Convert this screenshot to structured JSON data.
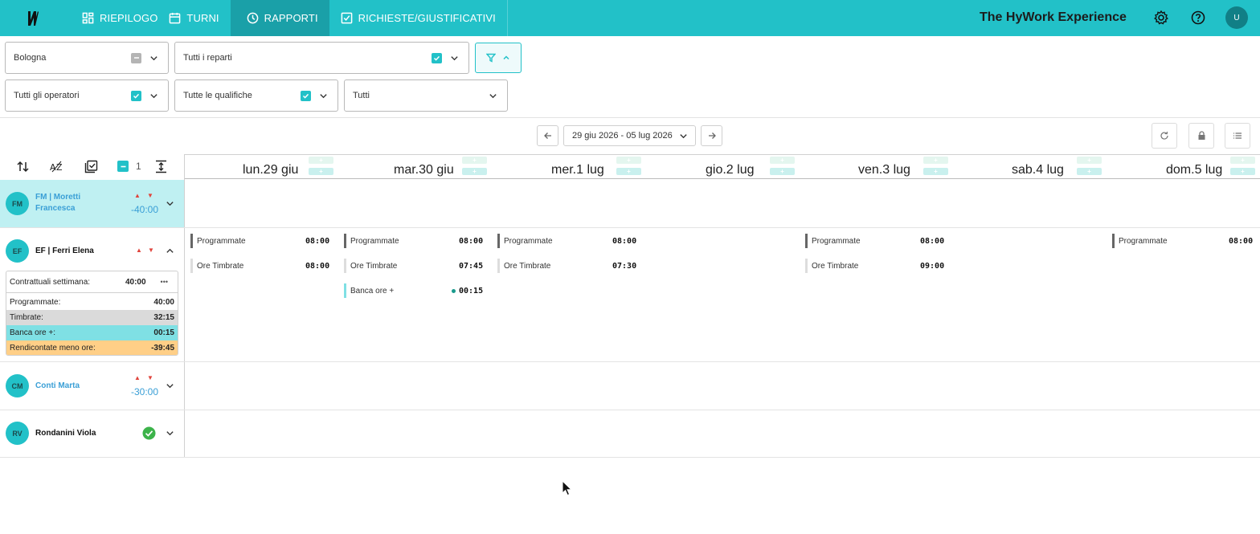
{
  "nav": {
    "items": [
      {
        "label": "RIEPILOGO",
        "icon": "dashboard-icon"
      },
      {
        "label": "TURNI",
        "icon": "calendar-icon"
      },
      {
        "label": "RAPPORTI",
        "icon": "clock-icon",
        "active": true
      },
      {
        "label": "RICHIESTE/GIUSTIFICATIVI",
        "icon": "checkbox-icon"
      }
    ],
    "brand": "The HyWork Experience",
    "user_initial": "U"
  },
  "filters": {
    "site": "Bologna",
    "departments": "Tutti i reparti",
    "operators": "Tutti gli operatori",
    "qualifications": "Tutte le qualifiche",
    "status": "Tutti"
  },
  "date_range": "29 giu 2026 - 05 lug 2026",
  "toolbar": {
    "selected_count": "1"
  },
  "days": [
    {
      "label": "lun.29 giu"
    },
    {
      "label": "mar.30 giu"
    },
    {
      "label": "mer.1 lug"
    },
    {
      "label": "gio.2 lug"
    },
    {
      "label": "ven.3 lug"
    },
    {
      "label": "sab.4 lug"
    },
    {
      "label": "dom.5 lug"
    }
  ],
  "employees": [
    {
      "initials": "FM",
      "name_line1": "FM | Moretti",
      "name_line2": "Francesca",
      "balance": "-40:00"
    },
    {
      "initials": "EF",
      "name": "EF | Ferri Elena"
    },
    {
      "initials": "CM",
      "name": "Conti Marta",
      "balance": "-30:00"
    },
    {
      "initials": "RV",
      "name": "Rondanini Viola"
    }
  ],
  "summary": {
    "contract_label": "Contrattuali settimana:",
    "contract_value": "40:00",
    "more": "•••",
    "rows": [
      {
        "label": "Programmate:",
        "value": "40:00"
      },
      {
        "label": "Timbrate:",
        "value": "32:15"
      },
      {
        "label": "Banca ore +:",
        "value": "00:15"
      },
      {
        "label": "Rendicontate meno ore:",
        "value": "-39:45"
      }
    ]
  },
  "entries": {
    "programmate_label": "Programmate",
    "timbrate_label": "Ore Timbrate",
    "banca_label": "Banca ore +",
    "mon": {
      "prog": "08:00",
      "timb": "08:00"
    },
    "tue": {
      "prog": "08:00",
      "timb": "07:45",
      "banca": "00:15"
    },
    "wed": {
      "prog": "08:00",
      "timb": "07:30"
    },
    "fri": {
      "prog": "08:00",
      "timb": "09:00"
    },
    "sun": {
      "prog": "08:00"
    }
  },
  "colors": {
    "accent": "#22c1c8",
    "accent_dark": "#1aa0a8",
    "banca": "#7fe0e4",
    "rendicontate": "#ffcf87",
    "negative": "#e0443c",
    "ok": "#3cb34a"
  }
}
